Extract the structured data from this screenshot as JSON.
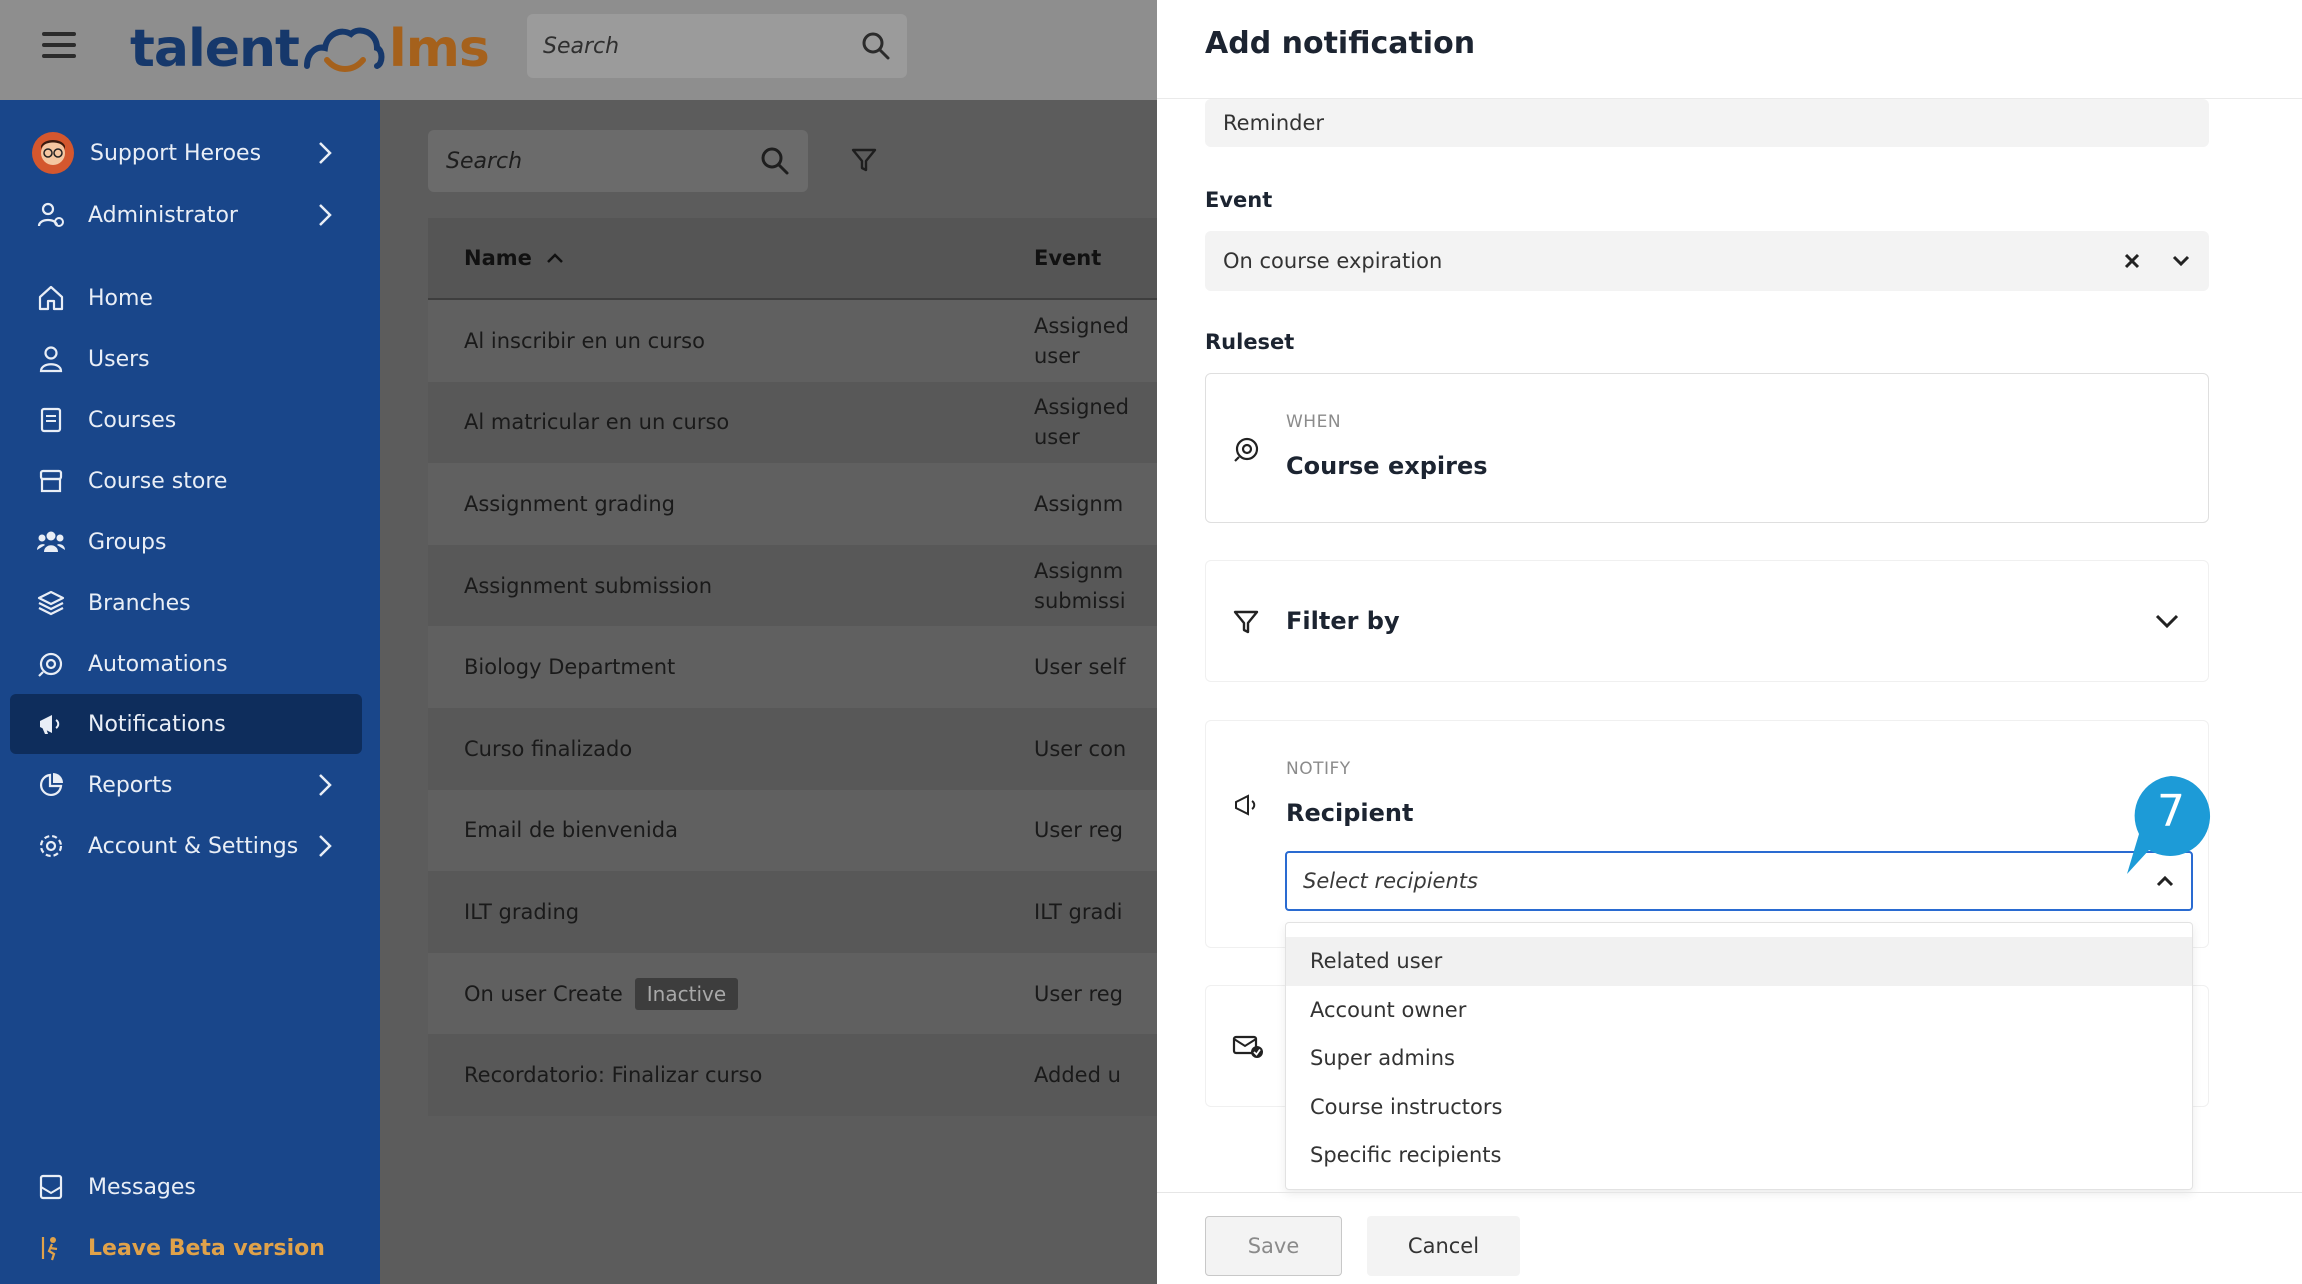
{
  "header": {
    "logo_left": "talent",
    "logo_right": "lms",
    "search_placeholder": "Search"
  },
  "sidebar": {
    "profile": "Support Heroes",
    "role": "Administrator",
    "items": [
      {
        "label": "Home",
        "icon": "home-icon"
      },
      {
        "label": "Users",
        "icon": "user-icon"
      },
      {
        "label": "Courses",
        "icon": "book-icon"
      },
      {
        "label": "Course store",
        "icon": "store-icon"
      },
      {
        "label": "Groups",
        "icon": "group-icon"
      },
      {
        "label": "Branches",
        "icon": "layers-icon"
      },
      {
        "label": "Automations",
        "icon": "automation-icon"
      },
      {
        "label": "Notifications",
        "icon": "megaphone-icon"
      },
      {
        "label": "Reports",
        "icon": "pie-chart-icon"
      },
      {
        "label": "Account & Settings",
        "icon": "gear-icon"
      }
    ],
    "messages": "Messages",
    "leave_beta": "Leave Beta version"
  },
  "main": {
    "search_placeholder": "Search",
    "columns": {
      "name": "Name",
      "event": "Event"
    },
    "rows": [
      {
        "name": "Al inscribir en un curso",
        "event": "Assigned user"
      },
      {
        "name": "Al matricular en un curso",
        "event": "Assigned user"
      },
      {
        "name": "Assignment grading",
        "event": "Assignm"
      },
      {
        "name": "Assignment submission",
        "event": "Assignm submissi"
      },
      {
        "name": "Biology Department",
        "event": "User self"
      },
      {
        "name": "Curso finalizado",
        "event": "User con"
      },
      {
        "name": "Email de bienvenida",
        "event": "User reg"
      },
      {
        "name": "ILT grading",
        "event": "ILT gradi"
      },
      {
        "name": "On user Create",
        "event": "User reg",
        "badge": "Inactive"
      },
      {
        "name": "Recordatorio: Finalizar curso",
        "event": "Added u"
      }
    ]
  },
  "panel": {
    "title": "Add notification",
    "name_value": "Reminder",
    "event_label": "Event",
    "event_value": "On course expiration",
    "ruleset_label": "Ruleset",
    "when_caption": "WHEN",
    "when_value": "Course expires",
    "filter_label": "Filter by",
    "notify_caption": "NOTIFY",
    "recipient_label": "Recipient",
    "recipient_placeholder": "Select recipients",
    "recipient_options": [
      "Related user",
      "Account owner",
      "Super admins",
      "Course instructors",
      "Specific recipients"
    ],
    "step_number": "7",
    "save_label": "Save",
    "cancel_label": "Cancel"
  },
  "colors": {
    "sidebar": "#19468a",
    "sidebar_active": "#0e2d5c",
    "accent": "#2a6bd1",
    "callout": "#1d9bd7",
    "beta": "#e0a24a"
  }
}
